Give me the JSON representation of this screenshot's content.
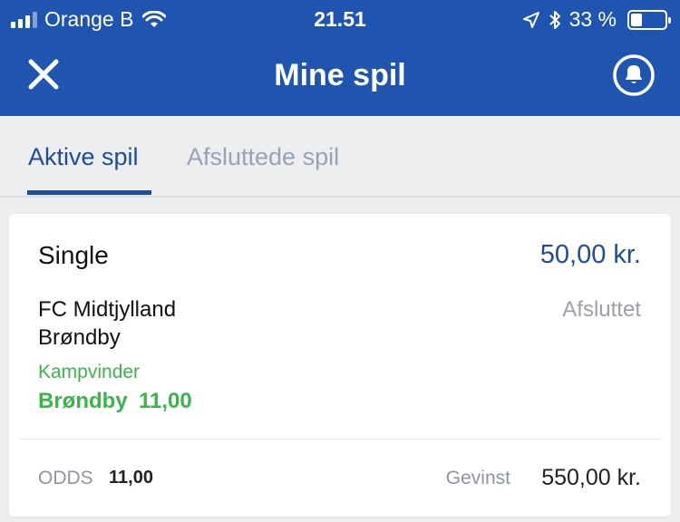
{
  "status_bar": {
    "carrier": "Orange B",
    "time": "21.51",
    "battery": "33 %",
    "battery_level": 0.33,
    "icons": [
      "signal-icon",
      "wifi-icon",
      "location-icon",
      "bluetooth-icon",
      "battery-icon"
    ]
  },
  "header": {
    "title": "Mine spil",
    "close_icon": "close-icon",
    "bell_icon": "bell-icon",
    "background": "#1f55b0"
  },
  "tabs": {
    "active": "Aktive spil",
    "inactive": "Afsluttede spil",
    "active_color": "#1f4c9a",
    "inactive_color": "#97a4b8"
  },
  "bet": {
    "type": "Single",
    "stake": "50,00 kr.",
    "team1": "FC Midtjylland",
    "team2": "Brøndby",
    "status": "Afsluttet",
    "market": "Kampvinder",
    "selection": "Brøndby",
    "selection_odds": "11,00",
    "odds_label": "ODDS",
    "odds_value": "11,00",
    "win_label": "Gevinst",
    "win_value": "550,00 kr.",
    "accent_green": "#3bb54a"
  }
}
